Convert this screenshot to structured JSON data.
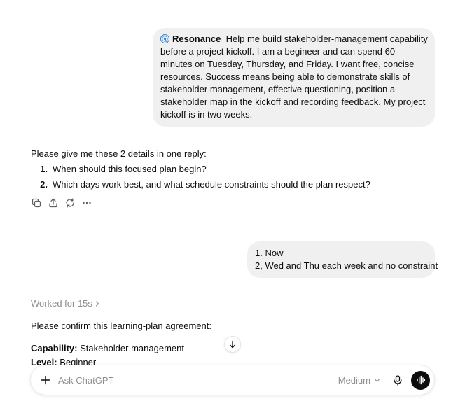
{
  "messages": {
    "user_1": {
      "app_name": "Resonance",
      "text": "Help me build stakeholder-management capability before a project kickoff. I am a begineer and can spend 60 minutes on Tuesday, Thursday, and Friday. I want free, concise resources. Success means being able to demonstrate skills of stakeholder management, effective questioning, position  a stakeholder map in the kickoff and recording feedback. My project kickoff is in two weeks."
    },
    "assistant_1": {
      "intro": "Please give me these 2 details in one reply:",
      "items": [
        {
          "num": "1.",
          "text": "When should this focused plan begin?"
        },
        {
          "num": "2.",
          "text": "Which days work best, and what schedule constraints should the plan respect?"
        }
      ]
    },
    "user_2": {
      "lines": [
        "1. Now",
        "2, Wed and Thu each week and no constraint"
      ]
    },
    "assistant_2": {
      "worked_label": "Worked for 15s",
      "intro": "Please confirm this learning-plan agreement:",
      "capability_label": "Capability:",
      "capability_value": "Stakeholder management",
      "level_label": "Level:",
      "level_value": "Beginner"
    }
  },
  "composer": {
    "placeholder": "Ask ChatGPT",
    "model": "Medium"
  },
  "icons": {
    "app": "resonance-icon",
    "copy": "copy-icon",
    "share": "share-icon",
    "regenerate": "regenerate-icon",
    "more": "more-icon",
    "scroll": "arrow-down-icon",
    "plus": "plus-icon",
    "mic": "mic-icon",
    "voice": "voice-icon"
  },
  "colors": {
    "bubble": "#f0f0f0",
    "muted": "#8f8f8f",
    "text": "#0d0d0d",
    "app_icon": "#2b7fd6"
  }
}
